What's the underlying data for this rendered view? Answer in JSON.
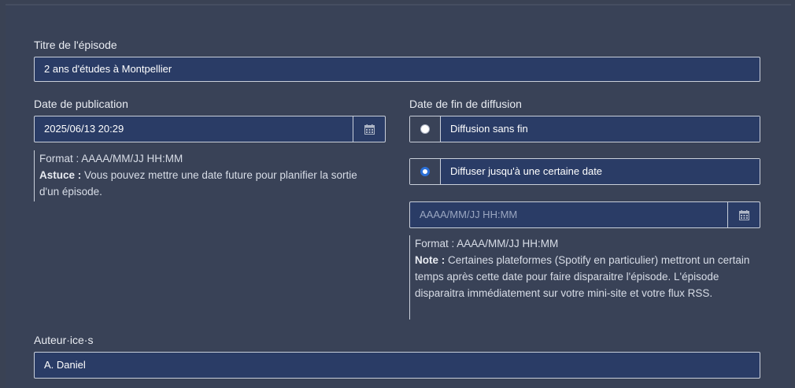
{
  "episode_title": {
    "label": "Titre de l'épisode",
    "value": "2 ans d'études à Montpellier"
  },
  "publication_date": {
    "label": "Date de publication",
    "value": "2025/06/13 20:29",
    "calendar_icon": "calendar-icon",
    "help_format": "Format : AAAA/MM/JJ HH:MM",
    "help_tip_label": "Astuce :",
    "help_tip_text": " Vous pouvez mettre une date future pour planifier la sortie d'un épisode."
  },
  "end_date": {
    "label": "Date de fin de diffusion",
    "option_no_end": "Diffusion sans fin",
    "option_until": "Diffuser jusqu'à une certaine date",
    "selected": "option_until",
    "placeholder": "AAAA/MM/JJ HH:MM",
    "calendar_icon": "calendar-icon",
    "help_format": "Format : AAAA/MM/JJ HH:MM",
    "help_note_label": "Note :",
    "help_note_text": " Certaines plateformes (Spotify en particulier) mettront un certain temps après cette date pour faire disparaitre l'épisode. L'épisode disparaitra immédiatement sur votre mini-site et votre flux RSS."
  },
  "authors": {
    "label": "Auteur·ice·s",
    "value": "A. Daniel"
  }
}
